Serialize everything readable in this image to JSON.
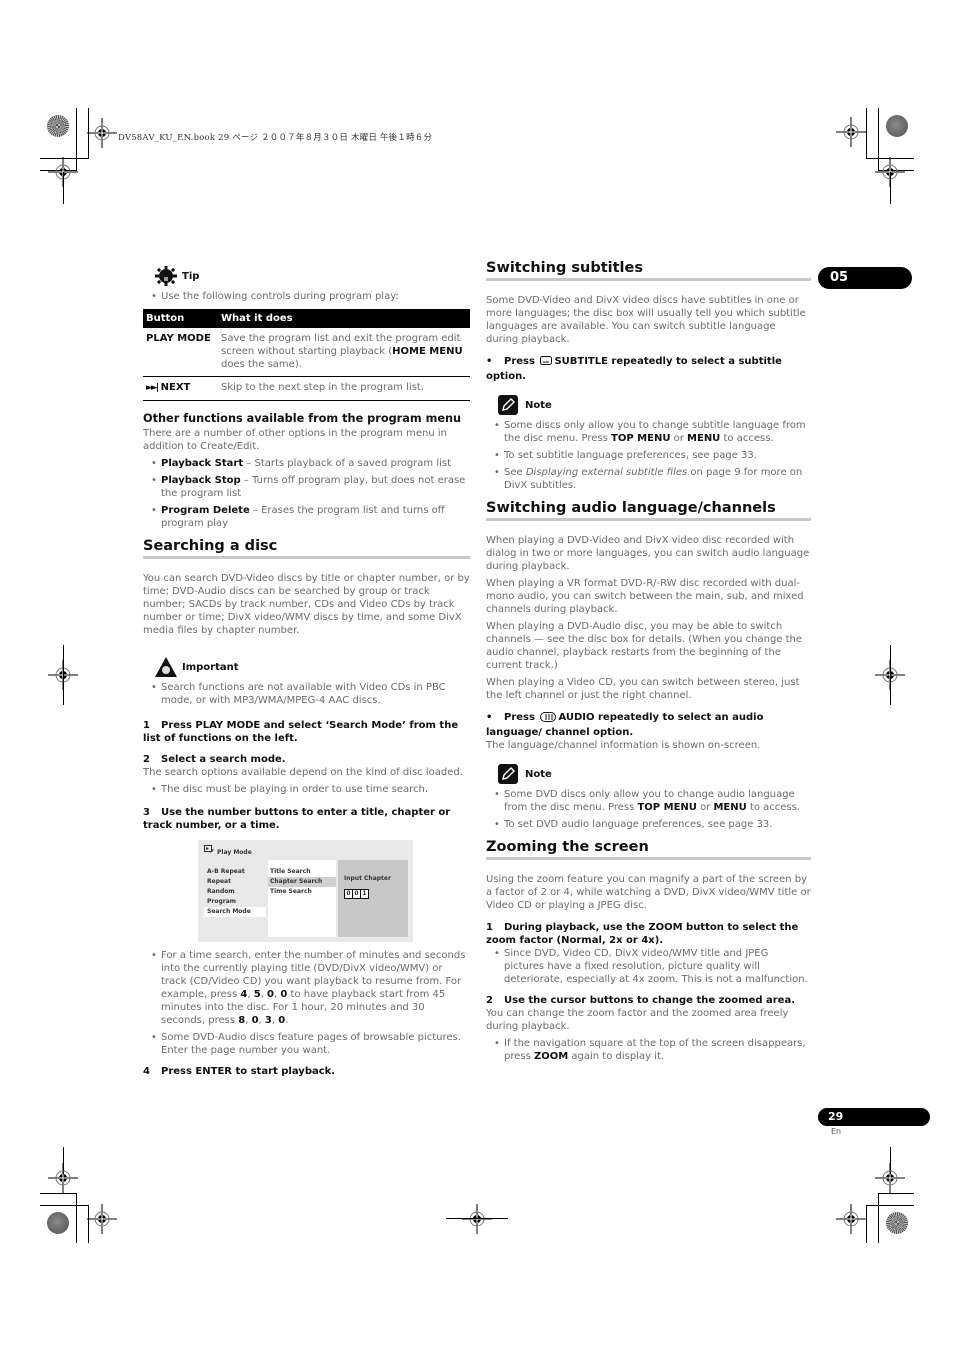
{
  "print_header": "DV58AV_KU_EN.book  29 ページ  ２００７年８月３０日  木曜日  午後１時６分",
  "chapter_tab": "05",
  "page_footer": {
    "number": "29",
    "lang": "En"
  },
  "left": {
    "tip": {
      "label": "Tip",
      "icon": "lightbulb-gear-icon",
      "intro": "Use the following controls during program play:",
      "table": {
        "headers": [
          "Button",
          "What it does"
        ],
        "rows": [
          {
            "button": "PLAY MODE",
            "desc_pre": "Save the program list and exit the program edit screen without starting playback (",
            "desc_bold": "HOME MENU",
            "desc_post": " does the same)."
          },
          {
            "button": "NEXT",
            "button_icon": "skip-next-icon",
            "desc": "Skip to the next step in the program list."
          }
        ]
      }
    },
    "other_functions": {
      "heading": "Other functions available from the program menu",
      "intro": "There are a number of other options in the program menu in addition to Create/Edit.",
      "items": [
        {
          "term": "Playback Start",
          "desc": " – Starts playback of a saved program list"
        },
        {
          "term": "Playback Stop",
          "desc": " – Turns off program play, but does not erase the program list"
        },
        {
          "term": "Program Delete",
          "desc": " – Erases the program list and turns off program play"
        }
      ]
    },
    "searching": {
      "heading": "Searching a disc",
      "intro": "You can search DVD-Video discs by title or chapter number, or by time; DVD-Audio discs can be searched by group or track number; SACDs by track number, CDs and Video CDs by track number or time; DivX video/WMV discs by time, and some DivX media files by chapter number.",
      "important": {
        "label": "Important",
        "icon": "warning-hand-icon",
        "items": [
          "Search functions are not available with Video CDs in PBC mode, or with MP3/WMA/MPEG-4 AAC discs."
        ]
      },
      "step1": {
        "num": "1",
        "text": "Press PLAY MODE and select ‘Search Mode’ from the list of functions on the left."
      },
      "step2": {
        "num": "2",
        "text": "Select a search mode.",
        "body": "The search options available depend on the kind of disc loaded.",
        "bullets": [
          "The disc must be playing in order to use time search."
        ]
      },
      "step3": {
        "num": "3",
        "text": "Use the number buttons to enter a title, chapter or track number, or a time."
      },
      "screen": {
        "title": "Play Mode",
        "menu_left": [
          "A-B Repeat",
          "Repeat",
          "Random",
          "Program",
          "Search Mode"
        ],
        "menu_left_selected": "Search Mode",
        "menu_mid": [
          "Title Search",
          "Chapter Search",
          "Time Search"
        ],
        "menu_mid_selected": "Chapter Search",
        "panel_label": "Input Chapter",
        "digits": [
          "0",
          "0",
          "1"
        ]
      },
      "bullet_time": {
        "p1": "For a time search, enter the number of minutes and seconds into the currently playing title (DVD/DivX video/WMV) or track (CD/Video CD) you want playback to resume from. For example, press ",
        "k1": "4",
        "k2": "5",
        "k3": "0",
        "k4": "0",
        "p2": " to have playback start from 45 minutes into the disc. For 1 hour, 20 minutes and 30 seconds, press ",
        "k5": "8",
        "k6": "0",
        "k7": "3",
        "k8": "0"
      },
      "bullet_pages": "Some DVD-Audio discs feature pages of browsable pictures. Enter the page number you want.",
      "step4": {
        "num": "4",
        "text": "Press ENTER to start playback."
      }
    }
  },
  "right": {
    "subtitles": {
      "heading": "Switching subtitles",
      "intro": "Some DVD-Video and DivX video discs have subtitles in one or more languages; the disc box will usually tell you which subtitle languages are available. You can switch subtitle language during playback.",
      "action": {
        "pre": "Press",
        "icon": "subtitle-icon",
        "post": "SUBTITLE repeatedly to select a subtitle option."
      },
      "note": {
        "label": "Note",
        "icon": "pencil-note-icon",
        "i1_pre": "Some discs only allow you to change subtitle language from the disc menu. Press ",
        "i1_b1": "TOP MENU",
        "i1_mid": " or ",
        "i1_b2": "MENU",
        "i1_post": " to access.",
        "i2": "To set subtitle language preferences, see page 33.",
        "i3_pre": "See ",
        "i3_italic": "Displaying external subtitle files",
        "i3_post": " on page 9 for more on DivX subtitles."
      }
    },
    "audio": {
      "heading": "Switching audio language/channels",
      "paras": [
        "When playing a DVD-Video and DivX video disc recorded with dialog in two or more languages, you can switch audio language during playback.",
        "When playing a VR format DVD-R/-RW disc recorded with dual-mono audio, you can switch between the main, sub, and mixed channels during playback.",
        "When playing a DVD-Audio disc, you may be able to switch channels — see the disc box for details. (When you change the audio channel, playback restarts from the beginning of the current track.)",
        "When playing a Video CD, you can switch between stereo, just the left channel or just the right channel."
      ],
      "action": {
        "pre": "Press",
        "icon": "audio-icon",
        "post": "AUDIO repeatedly to select an audio language/ channel option."
      },
      "action_body": "The language/channel information is shown on-screen.",
      "note": {
        "label": "Note",
        "icon": "pencil-note-icon",
        "i1_pre": "Some DVD discs only allow you to change audio language from the disc menu. Press ",
        "i1_b1": "TOP MENU",
        "i1_mid": " or ",
        "i1_b2": "MENU",
        "i1_post": " to access.",
        "i2": "To set DVD audio language preferences, see page 33."
      }
    },
    "zoom": {
      "heading": "Zooming the screen",
      "intro": "Using the zoom feature you can magnify a part of the screen by a factor of 2 or 4, while watching a DVD, DivX video/WMV title or Video CD or playing a JPEG disc.",
      "step1": {
        "num": "1",
        "text": "During playback, use the ZOOM button to select the zoom factor (Normal, 2x or 4x)."
      },
      "step1_bullets": [
        "Since DVD, Video CD, DivX video/WMV title and JPEG pictures have a fixed resolution, picture quality will deteriorate, especially at 4x zoom. This is not a malfunction."
      ],
      "step2": {
        "num": "2",
        "text": "Use the cursor buttons to change the zoomed area."
      },
      "step2_body": "You can change the zoom factor and the zoomed area freely during playback.",
      "step2_bullet": {
        "pre": "If the navigation square at the top of the screen disappears, press ",
        "bold": "ZOOM",
        "post": " again to display it."
      }
    }
  }
}
